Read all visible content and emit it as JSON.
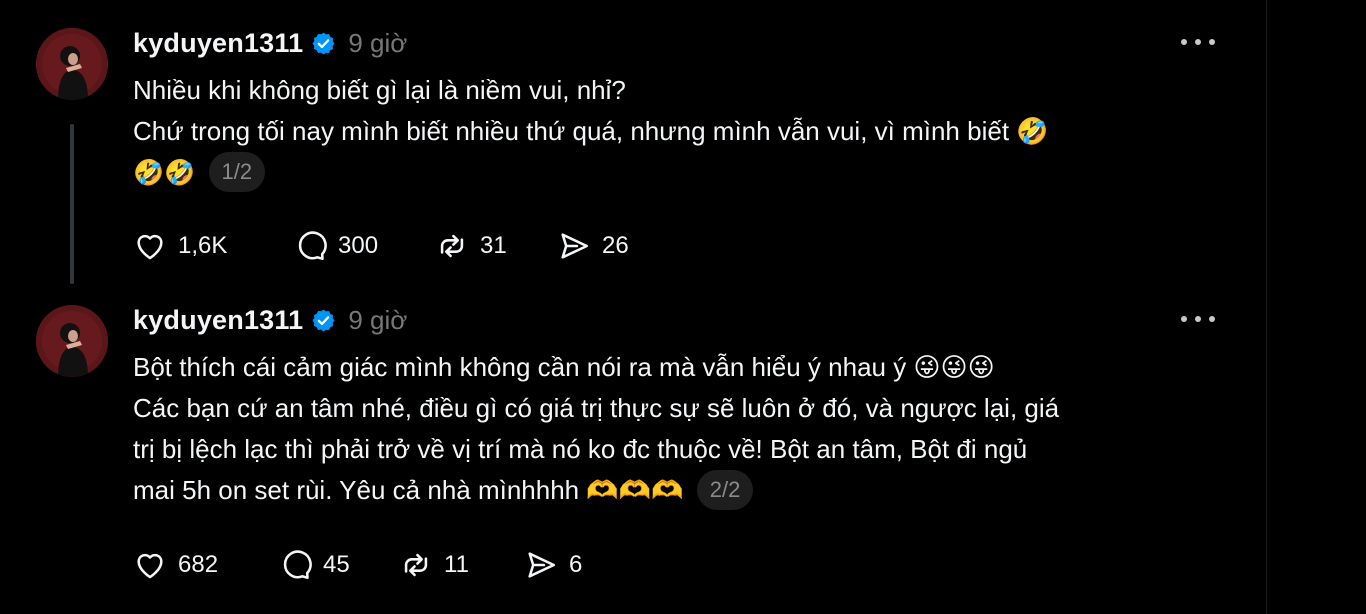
{
  "posts": [
    {
      "username": "kyduyen1311",
      "time": "9 giờ",
      "lines": [
        "Nhiều khi không biết gì lại là niềm vui, nhỉ?",
        "Chứ trong tối nay mình biết nhiều thứ quá, nhưng mình vẫn vui, vì mình biết 🤣",
        "🤣🤣"
      ],
      "pager": "1/2",
      "likes": "1,6K",
      "comments": "300",
      "reposts": "31",
      "shares": "26"
    },
    {
      "username": "kyduyen1311",
      "time": "9 giờ",
      "lines": [
        "Bột thích cái cảm giác mình không cần nói ra mà vẫn hiểu ý nhau ý 😜😜😜",
        "Các bạn cứ an tâm nhé, điều gì có giá trị thực sự sẽ luôn ở đó, và ngược lại, giá",
        "trị bị lệch lạc thì phải trở về vị trí mà nó ko đc thuộc về! Bột an tâm, Bột đi ngủ",
        "mai 5h on set rùi. Yêu cả nhà mìnhhhh 🫶🫶🫶"
      ],
      "pager": "2/2",
      "likes": "682",
      "comments": "45",
      "reposts": "11",
      "shares": "6"
    }
  ],
  "icons": {
    "verified": "verified-badge-icon",
    "more": "more-horizontal-icon",
    "like": "heart-icon",
    "comment": "comment-bubble-icon",
    "repost": "repost-icon",
    "share": "send-icon"
  },
  "colors": {
    "background": "#000000",
    "text": "#f3f5f7",
    "muted": "#777777",
    "verified": "#0095f6",
    "pill_bg": "#1e1e1e"
  }
}
